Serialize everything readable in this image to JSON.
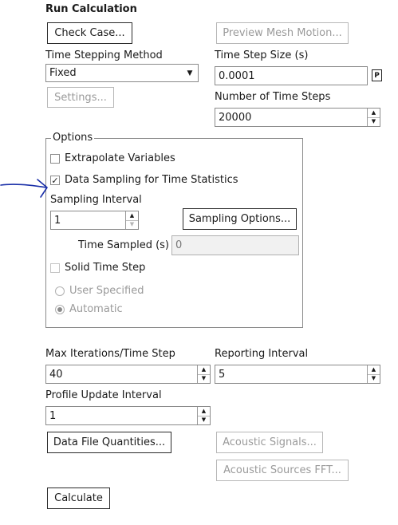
{
  "run_calculation": {
    "title": "Run Calculation",
    "check_case_label": "Check Case...",
    "preview_mesh_motion_label": "Preview Mesh Motion...",
    "time_stepping_method_label": "Time Stepping Method",
    "time_stepping_method_value": "Fixed",
    "settings_label": "Settings...",
    "time_step_size_label": "Time Step Size (s)",
    "time_step_size_value": "0.0001",
    "parameter_badge": "P",
    "number_of_time_steps_label": "Number of Time Steps",
    "number_of_time_steps_value": "20000"
  },
  "options": {
    "legend": "Options",
    "extrapolate_variables_label": "Extrapolate Variables",
    "extrapolate_variables_checked": false,
    "data_sampling_label": "Data Sampling for Time Statistics",
    "data_sampling_checked": true,
    "sampling_interval_label": "Sampling Interval",
    "sampling_interval_value": "1",
    "sampling_options_label": "Sampling Options...",
    "time_sampled_label": "Time Sampled (s)",
    "time_sampled_value": "0",
    "solid_time_step_label": "Solid Time Step",
    "solid_time_step_checked": false,
    "user_specified_label": "User Specified",
    "automatic_label": "Automatic",
    "selected_radio": "Automatic"
  },
  "iteration": {
    "max_iterations_label": "Max Iterations/Time Step",
    "max_iterations_value": "40",
    "reporting_interval_label": "Reporting Interval",
    "reporting_interval_value": "5",
    "profile_update_label": "Profile Update Interval",
    "profile_update_value": "1"
  },
  "buttons": {
    "data_file_quantities_label": "Data File Quantities...",
    "acoustic_signals_label": "Acoustic Signals...",
    "acoustic_sources_fft_label": "Acoustic Sources FFT...",
    "calculate_label": "Calculate"
  },
  "annotation": {
    "arrow_color": "#1a2fa8"
  }
}
